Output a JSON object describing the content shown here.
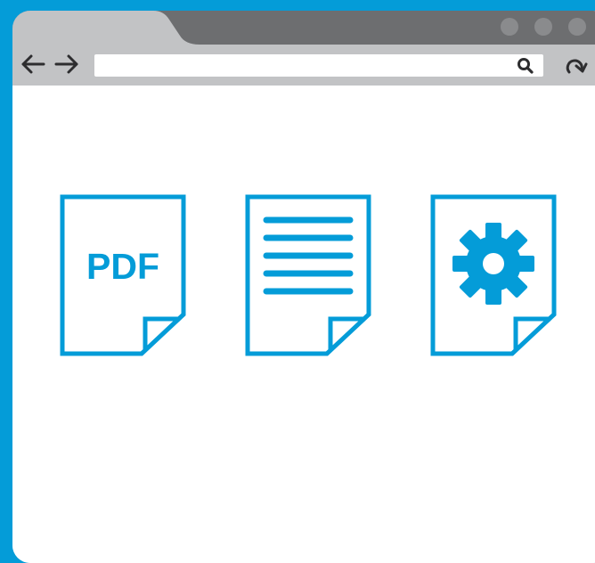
{
  "browser": {
    "address_bar": {
      "value": "",
      "placeholder": ""
    },
    "icons": {
      "back": "arrow-left-icon",
      "forward": "arrow-right-icon",
      "search": "search-icon",
      "reload": "reload-icon"
    }
  },
  "page": {
    "documents": [
      {
        "type": "pdf",
        "label": "PDF"
      },
      {
        "type": "text",
        "label": ""
      },
      {
        "type": "settings",
        "label": ""
      }
    ]
  },
  "colors": {
    "accent": "#049cd8",
    "title_bar": "#6d6e70",
    "toolbar": "#c2c3c5",
    "tab": "#c2c3c5",
    "window_dot": "#8a8b8d",
    "content_bg": "#ffffff"
  }
}
